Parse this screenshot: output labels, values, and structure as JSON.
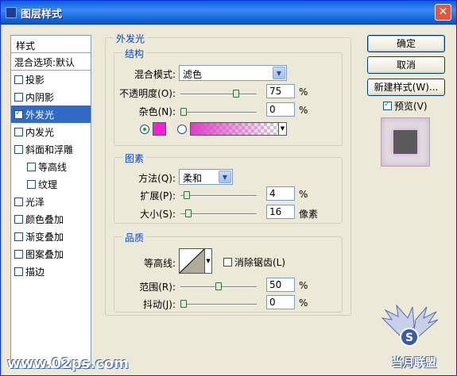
{
  "window": {
    "title": "图层样式",
    "close_label": "✕"
  },
  "sidebar": {
    "header": "样式",
    "blend_default": "混合选项:默认",
    "items": [
      {
        "label": "投影",
        "checked": false,
        "indent": false,
        "selected": false
      },
      {
        "label": "内阴影",
        "checked": false,
        "indent": false,
        "selected": false
      },
      {
        "label": "外发光",
        "checked": true,
        "indent": false,
        "selected": true
      },
      {
        "label": "内发光",
        "checked": false,
        "indent": false,
        "selected": false
      },
      {
        "label": "斜面和浮雕",
        "checked": false,
        "indent": false,
        "selected": false
      },
      {
        "label": "等高线",
        "checked": false,
        "indent": true,
        "selected": false
      },
      {
        "label": "纹理",
        "checked": false,
        "indent": true,
        "selected": false
      },
      {
        "label": "光泽",
        "checked": false,
        "indent": false,
        "selected": false
      },
      {
        "label": "颜色叠加",
        "checked": false,
        "indent": false,
        "selected": false
      },
      {
        "label": "渐变叠加",
        "checked": false,
        "indent": false,
        "selected": false
      },
      {
        "label": "图案叠加",
        "checked": false,
        "indent": false,
        "selected": false
      },
      {
        "label": "描边",
        "checked": false,
        "indent": false,
        "selected": false
      }
    ]
  },
  "panel": {
    "title": "外发光",
    "structure": {
      "title": "结构",
      "blend_mode_label": "混合模式:",
      "blend_mode_value": "滤色",
      "opacity_label": "不透明度(O):",
      "opacity_value": "75",
      "opacity_fraction": 0.75,
      "noise_label": "杂色(N):",
      "noise_value": "0",
      "noise_fraction": 0,
      "percent": "%",
      "glow_color": "#ff1cd8",
      "gradient_from": "#e03cc8"
    },
    "elements": {
      "title": "图素",
      "method_label": "方法(Q):",
      "method_value": "柔和",
      "spread_label": "扩展(P):",
      "spread_value": "4",
      "spread_fraction": 0.04,
      "size_label": "大小(S):",
      "size_value": "16",
      "size_fraction": 0.064,
      "percent": "%",
      "pixels": "像素"
    },
    "quality": {
      "title": "品质",
      "contour_label": "等高线:",
      "antialias_label": "消除锯齿(L)",
      "antialias_checked": false,
      "range_label": "范围(R):",
      "range_value": "50",
      "range_fraction": 0.5,
      "jitter_label": "抖动(J):",
      "jitter_value": "0",
      "jitter_fraction": 0,
      "percent": "%"
    }
  },
  "buttons": {
    "ok": "确定",
    "cancel": "取消",
    "new_style": "新建样式(W)...",
    "preview_label": "预览(V)",
    "preview_checked": true
  },
  "watermark": {
    "left": "www.02ps.com",
    "right": "当月联盟"
  }
}
